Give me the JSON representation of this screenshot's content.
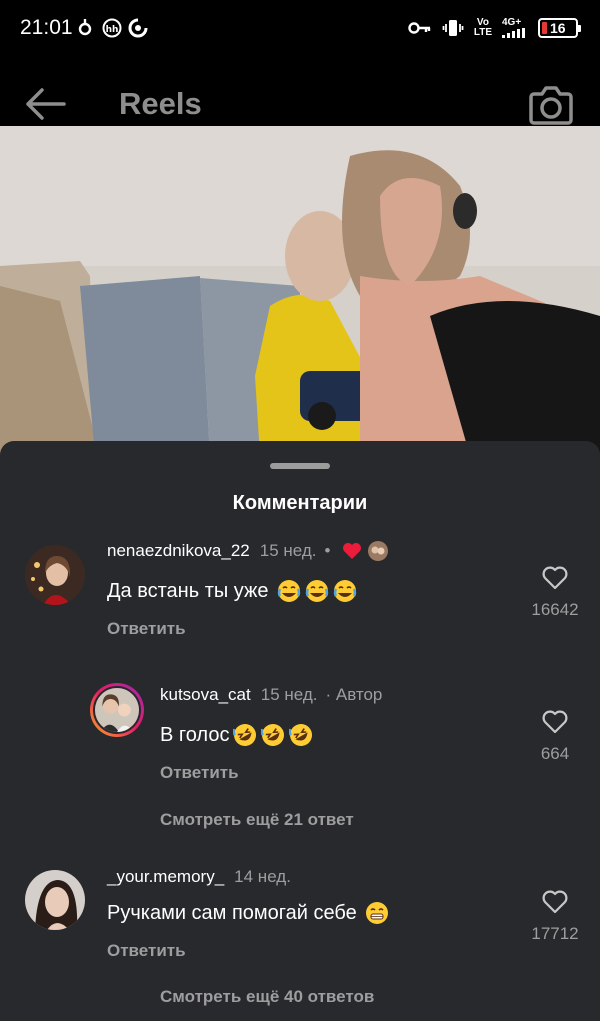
{
  "status_bar": {
    "time": "21:01",
    "network_top": "Vo",
    "network_bottom": "LTE",
    "signal_label": "4G+",
    "battery": "16",
    "battery_color": "#e53935"
  },
  "header": {
    "title": "Reels",
    "back_icon": "arrow-left-icon",
    "camera_icon": "camera-icon"
  },
  "comments_sheet": {
    "title": "Комментарии",
    "comments": [
      {
        "username": "nenaezdnikova_22",
        "time": "15 нед.",
        "text": "Да встань ты уже",
        "emojis": [
          "joy",
          "joy",
          "joy"
        ],
        "reply_label": "Ответить",
        "likes": "16642",
        "creator_liked": true
      },
      {
        "username": "kutsova_cat",
        "time": "15 нед.",
        "author_label": "· Автор",
        "text": "В голос",
        "emojis": [
          "rofl",
          "rofl",
          "rofl"
        ],
        "reply_label": "Ответить",
        "likes": "664"
      },
      {
        "username": "_your.memory_",
        "time": "14 нед.",
        "text": "Ручками сам помогай себе",
        "emojis": [
          "grin"
        ],
        "reply_label": "Ответить",
        "likes": "17712"
      }
    ],
    "view_more_1": "Смотреть ещё 21 ответ",
    "view_more_2": "Смотреть ещё 40 ответов"
  },
  "colors": {
    "sheet_bg": "#27292c",
    "secondary_text": "#9e9e9e",
    "like_heart": "#ed1c3b"
  }
}
